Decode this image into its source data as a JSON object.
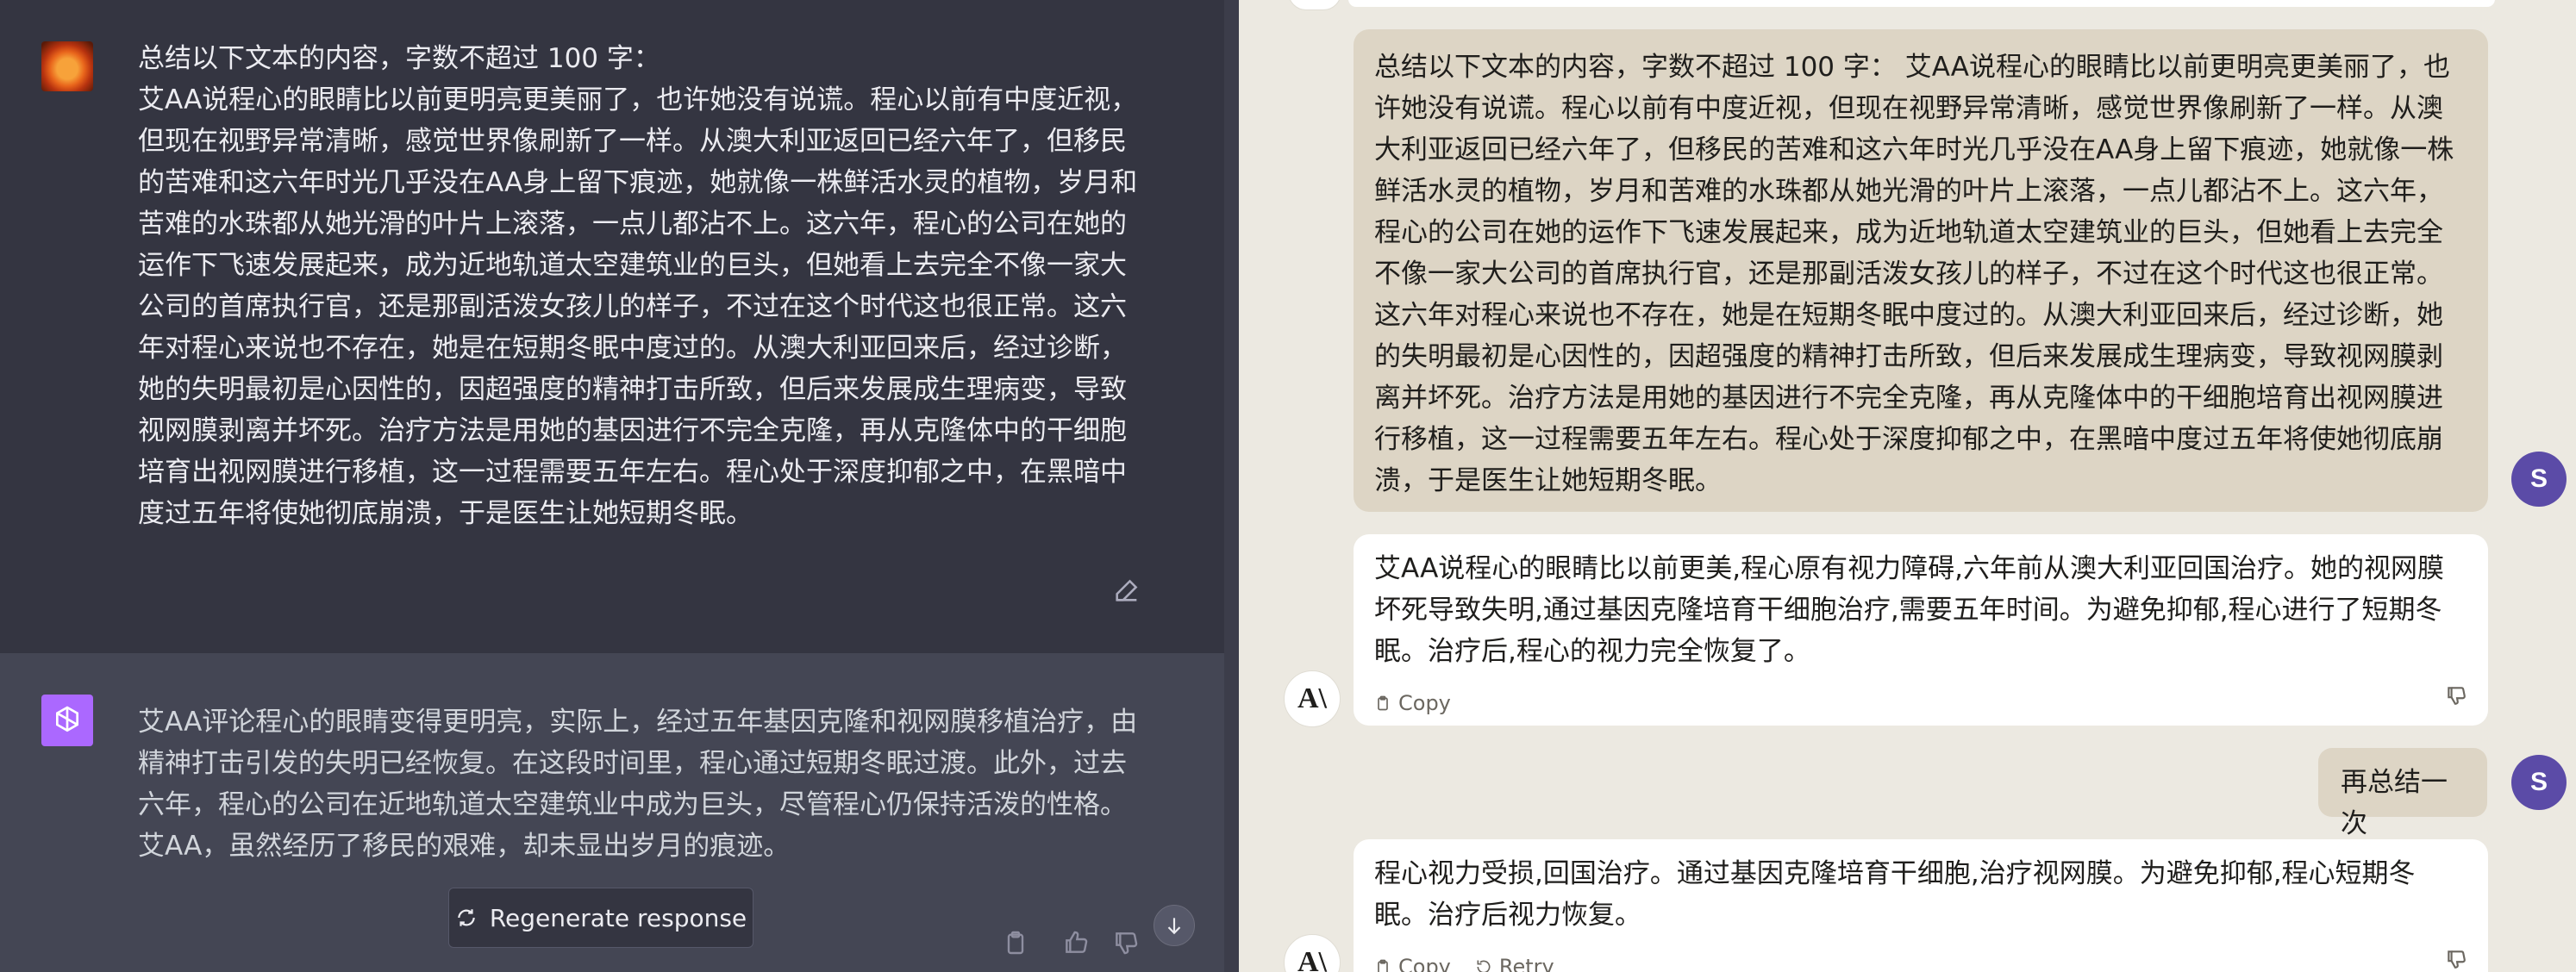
{
  "left_panel": {
    "user_message": "总结以下文本的内容，字数不超过 100 字：\n艾AA说程心的眼睛比以前更明亮更美丽了，也许她没有说谎。程心以前有中度近视，但现在视野异常清晰，感觉世界像刷新了一样。从澳大利亚返回已经六年了，但移民的苦难和这六年时光几乎没在AA身上留下痕迹，她就像一株鲜活水灵的植物，岁月和苦难的水珠都从她光滑的叶片上滚落，一点儿都沾不上。这六年，程心的公司在她的运作下飞速发展起来，成为近地轨道太空建筑业的巨头，但她看上去完全不像一家大公司的首席执行官，还是那副活泼女孩儿的样子，不过在这个时代这也很正常。这六年对程心来说也不存在，她是在短期冬眠中度过的。从澳大利亚回来后，经过诊断，她的失明最初是心因性的，因超强度的精神打击所致，但后来发展成生理病变，导致视网膜剥离并坏死。治疗方法是用她的基因进行不完全克隆，再从克隆体中的干细胞培育出视网膜进行移植，这一过程需要五年左右。程心处于深度抑郁之中，在黑暗中度过五年将使她彻底崩溃，于是医生让她短期冬眠。",
    "assistant_message": "艾AA评论程心的眼睛变得更明亮，实际上，经过五年基因克隆和视网膜移植治疗，由精神打击引发的失明已经恢复。在这段时间里，程心通过短期冬眠过渡。此外，过去六年，程心的公司在近地轨道太空建筑业中成为巨头，尽管程心仍保持活泼的性格。艾AA，虽然经历了移民的艰难，却未显出岁月的痕迹。",
    "regenerate_label": "Regenerate response",
    "icons": [
      "edit-icon",
      "openai-logo-icon",
      "regenerate-icon",
      "clipboard-icon",
      "thumbs-up-icon",
      "thumbs-down-icon",
      "arrow-down-icon"
    ]
  },
  "right_panel": {
    "user_message_1": "总结以下文本的内容，字数不超过 100 字： 艾AA说程心的眼睛比以前更明亮更美丽了，也许她没有说谎。程心以前有中度近视，但现在视野异常清晰，感觉世界像刷新了一样。从澳大利亚返回已经六年了，但移民的苦难和这六年时光几乎没在AA身上留下痕迹，她就像一株鲜活水灵的植物，岁月和苦难的水珠都从她光滑的叶片上滚落，一点儿都沾不上。这六年，程心的公司在她的运作下飞速发展起来，成为近地轨道太空建筑业的巨头，但她看上去完全不像一家大公司的首席执行官，还是那副活泼女孩儿的样子，不过在这个时代这也很正常。这六年对程心来说也不存在，她是在短期冬眠中度过的。从澳大利亚回来后，经过诊断，她的失明最初是心因性的，因超强度的精神打击所致，但后来发展成生理病变，导致视网膜剥离并坏死。治疗方法是用她的基因进行不完全克隆，再从克隆体中的干细胞培育出视网膜进行移植，这一过程需要五年左右。程心处于深度抑郁之中，在黑暗中度过五年将使她彻底崩溃，于是医生让她短期冬眠。",
    "assistant_message_1": "艾AA说程心的眼睛比以前更美,程心原有视力障碍,六年前从澳大利亚回国治疗。她的视网膜坏死导致失明,通过基因克隆培育干细胞治疗,需要五年时间。为避免抑郁,程心进行了短期冬眠。治疗后,程心的视力完全恢复了。",
    "user_message_2": "再总结一次",
    "assistant_message_2": "程心视力受损,回国治疗。通过基因克隆培育干细胞,治疗视网膜。为避免抑郁,程心短期冬眠。治疗后视力恢复。",
    "user_avatar_initial": "S",
    "ai_avatar_label": "A\\",
    "copy_label": "Copy",
    "retry_label": "Retry",
    "colors": {
      "user_bubble": "#ddd5c5",
      "background": "#ece9e1",
      "avatar": "#5b4ba7"
    }
  }
}
